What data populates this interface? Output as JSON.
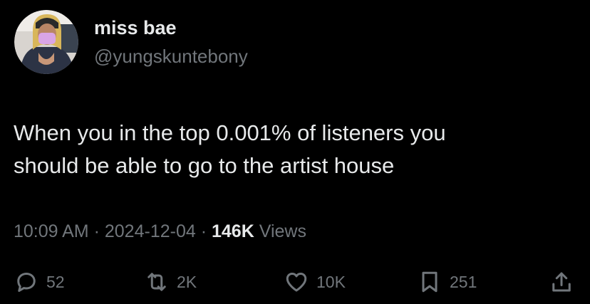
{
  "author": {
    "display_name": "miss bae",
    "handle": "@yungskuntebony"
  },
  "tweet": {
    "text_line1": "When you in the top 0.001% of listeners you",
    "text_line2": "should be able to go to the artist house"
  },
  "meta": {
    "time": "10:09 AM",
    "separator": "·",
    "date": "2024-12-04",
    "views_count": "146K",
    "views_label": "Views"
  },
  "actions": {
    "replies": "52",
    "reposts": "2K",
    "likes": "10K",
    "bookmarks": "251"
  },
  "colors": {
    "background": "#000000",
    "primary_text": "#e7e9ea",
    "secondary_text": "#71767b"
  },
  "icons": {
    "reply": "speech-bubble-icon",
    "repost": "repost-arrows-icon",
    "like": "heart-icon",
    "bookmark": "bookmark-icon",
    "share": "share-upload-icon"
  }
}
